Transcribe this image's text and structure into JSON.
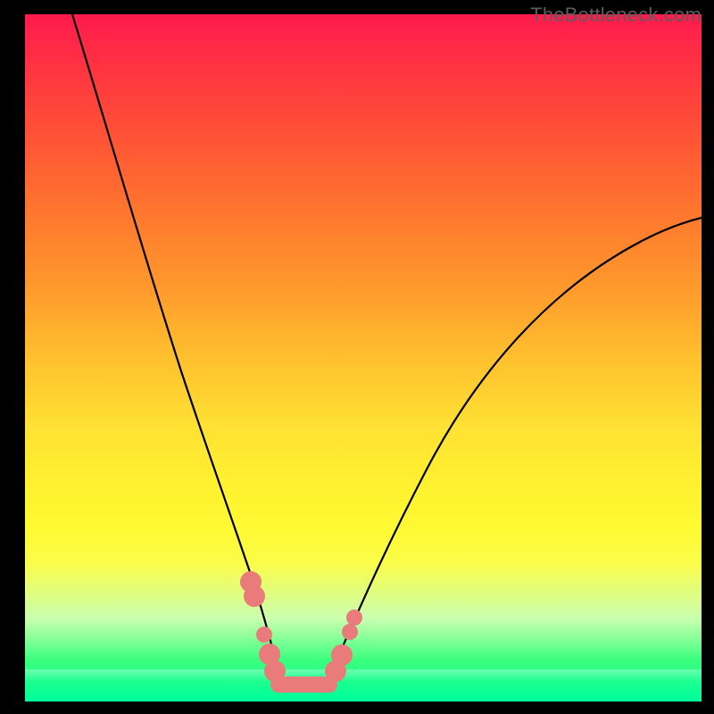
{
  "attribution": "TheBottleneck.com",
  "chart_data": {
    "type": "line",
    "title": "",
    "xlabel": "",
    "ylabel": "",
    "series": [
      {
        "name": "left-curve",
        "x": [
          0.07,
          0.1,
          0.14,
          0.18,
          0.22,
          0.26,
          0.3,
          0.33,
          0.355,
          0.375
        ],
        "values": [
          1.0,
          0.83,
          0.64,
          0.48,
          0.34,
          0.23,
          0.14,
          0.08,
          0.04,
          0.02
        ]
      },
      {
        "name": "right-curve",
        "x": [
          0.45,
          0.5,
          0.56,
          0.63,
          0.71,
          0.8,
          0.9,
          1.0
        ],
        "values": [
          0.02,
          0.07,
          0.15,
          0.25,
          0.37,
          0.49,
          0.6,
          0.7
        ]
      }
    ],
    "plateau": {
      "x_start": 0.375,
      "x_end": 0.45,
      "y": 0.02
    },
    "markers": [
      {
        "curve": "left-curve",
        "x": 0.33,
        "y": 0.18
      },
      {
        "curve": "left-curve",
        "x": 0.337,
        "y": 0.155
      },
      {
        "curve": "left-curve",
        "x": 0.355,
        "y": 0.09
      },
      {
        "curve": "left-curve",
        "x": 0.365,
        "y": 0.06
      },
      {
        "curve": "left-curve",
        "x": 0.375,
        "y": 0.035
      },
      {
        "curve": "right-curve",
        "x": 0.455,
        "y": 0.035
      },
      {
        "curve": "right-curve",
        "x": 0.465,
        "y": 0.06
      },
      {
        "curve": "right-curve",
        "x": 0.478,
        "y": 0.105
      },
      {
        "curve": "right-curve",
        "x": 0.484,
        "y": 0.125
      }
    ],
    "xlim": [
      0,
      1
    ],
    "ylim": [
      0,
      1
    ],
    "background_gradient": [
      "#ff1a4d",
      "#ff7a2e",
      "#ffe133",
      "#00ff9a"
    ],
    "plateau_color": "#e97b7a",
    "marker_color": "#e97b7a"
  }
}
